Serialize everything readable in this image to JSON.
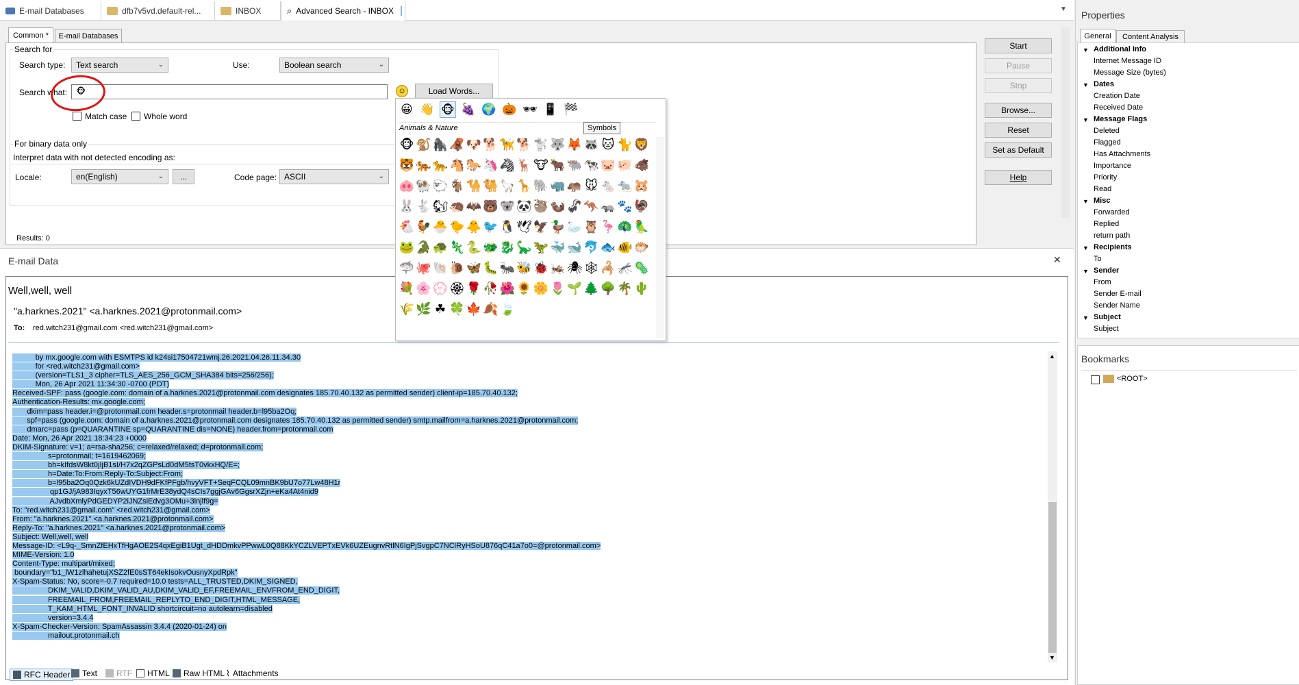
{
  "tabs": [
    {
      "label": "E-mail Databases",
      "icon": "envelope-icon"
    },
    {
      "label": "dfb7v5vd.default-rel...",
      "icon": "folder-icon"
    },
    {
      "label": "INBOX",
      "icon": "inbox-icon"
    },
    {
      "label": "Advanced Search - INBOX",
      "icon": "search-icon"
    }
  ],
  "search_tabs": [
    "Common *",
    "E-mail Databases"
  ],
  "search_for": {
    "group_title": "Search for",
    "search_type_label": "Search type:",
    "search_type_value": "Text search",
    "use_label": "Use:",
    "use_value": "Boolean search",
    "search_what_label": "Search what:",
    "search_what_value": "🐵",
    "load_words": "Load Words...",
    "match_case": "Match case",
    "whole_word": "Whole word"
  },
  "binary": {
    "group_title": "For binary data only",
    "interpret_label": "Interpret data with not detected encoding as:",
    "locale_label": "Locale:",
    "locale_value": "en(English)",
    "ellipsis": "...",
    "codepage_label": "Code page:",
    "codepage_value": "ASCII"
  },
  "action_buttons": {
    "start": "Start",
    "pause": "Pause",
    "stop": "Stop",
    "browse": "Browse...",
    "reset": "Reset",
    "set_default": "Set as Default",
    "help": "Help"
  },
  "results": "Results:   0",
  "emoji_picker": {
    "category_title": "Animals & Nature",
    "tooltip": "Symbols",
    "categories": [
      "😀",
      "👋",
      "🐵",
      "🍇",
      "🌍",
      "🎃",
      "🕶",
      "📱",
      "🏁"
    ],
    "rows": [
      [
        "🐵",
        "🐒",
        "🦍",
        "🦧",
        "🐶",
        "🐕",
        "🦮",
        "🐕",
        "🐩",
        "🐺",
        "🦊",
        "🦝",
        "🐱",
        "🐈",
        "🦁"
      ],
      [
        "🐯",
        "🐅",
        "🐆",
        "🐴",
        "🐎",
        "🦄",
        "🦓",
        "🦌",
        "🐮",
        "🐂",
        "🐃",
        "🐄",
        "🐷",
        "🐖",
        "🐗"
      ],
      [
        "🐽",
        "🐏",
        "🐑",
        "🐐",
        "🐪",
        "🐫",
        "🦙",
        "🦒",
        "🐘",
        "🦏",
        "🦛",
        "🐭",
        "🐁",
        "🐀",
        "🐹"
      ],
      [
        "🐰",
        "🐇",
        "🐿",
        "🦔",
        "🦇",
        "🐻",
        "🐨",
        "🐼",
        "🦥",
        "🦦",
        "🦨",
        "🦘",
        "🦡",
        "🐾",
        "🦃"
      ],
      [
        "🐔",
        "🐓",
        "🐣",
        "🐤",
        "🐥",
        "🐦",
        "🐧",
        "🕊",
        "🦅",
        "🦆",
        "🦢",
        "🦉",
        "🦩",
        "🦚",
        "🦜"
      ],
      [
        "🐸",
        "🐊",
        "🐢",
        "🦎",
        "🐍",
        "🐲",
        "🐉",
        "🦕",
        "🦖",
        "🐳",
        "🐋",
        "🐬",
        "🐟",
        "🐠",
        "🐡"
      ],
      [
        "🦈",
        "🐙",
        "🐚",
        "🐌",
        "🦋",
        "🐛",
        "🐜",
        "🐝",
        "🐞",
        "🦗",
        "🕷",
        "🕸",
        "🦂",
        "🦟",
        "🦠"
      ],
      [
        "💐",
        "🌸",
        "💮",
        "🏵",
        "🌹",
        "🥀",
        "🌺",
        "🌻",
        "🌼",
        "🌷",
        "🌱",
        "🌲",
        "🌳",
        "🌴",
        "🌵"
      ],
      [
        "🌾",
        "🌿",
        "☘",
        "🍀",
        "🍁",
        "🍂",
        "🍃"
      ]
    ]
  },
  "email_panel": {
    "title": "E-mail Data",
    "subject": "Well,well, well",
    "from": "\"a.harknes.2021\" <a.harknes.2021@protonmail.com>",
    "to_label": "To:",
    "to_value": "red.witch231@gmail.com <red.witch231@gmail.com>",
    "header_lines": [
      "           by mx.google.com with ESMTPS id k24si17504721wmj.26.2021.04.26.11.34.30",
      "           for <red.witch231@gmail.com>",
      "           (version=TLS1_3 cipher=TLS_AES_256_GCM_SHA384 bits=256/256);",
      "           Mon, 26 Apr 2021 11:34:30 -0700 (PDT)",
      "Received-SPF: pass (google.com: domain of a.harknes.2021@protonmail.com designates 185.70.40.132 as permitted sender) client-ip=185.70.40.132;",
      "Authentication-Results: mx.google.com;",
      "       dkim=pass header.i=@protonmail.com header.s=protonmail header.b=l95ba2Oq;",
      "       spf=pass (google.com: domain of a.harknes.2021@protonmail.com designates 185.70.40.132 as permitted sender) smtp.mailfrom=a.harknes.2021@protonmail.com;",
      "       dmarc=pass (p=QUARANTINE sp=QUARANTINE dis=NONE) header.from=protonmail.com",
      "Date: Mon, 26 Apr 2021 18:34:23 +0000",
      "DKIM-Signature: v=1; a=rsa-sha256; c=relaxed/relaxed; d=protonmail.com;",
      "                 s=protonmail; t=1619462069;",
      "                 bh=kIfdsW8kt0jIjB1sI/H7x2qZGPsLd0dM5tsT0vkxHQ/E=;",
      "                 h=Date:To:From:Reply-To:Subject:From;",
      "                 b=l95ba2Oq0Qzk6kUZdIVDH9dFKfPFgb/hvyVFT+SeqFCQL09mnBK9bU7o77Lw48H1r",
      "                  qp1GJ/jA983IqyxT56wUYG1frMrE38ydQ4sCIs7ggjGAv6GgsrXZjn+eKa4At4nid9",
      "                  AJvdbXmlyPdGEDYP2iJNZsiEdvg3OMu+3lnjlf9g=",
      "To: \"red.witch231@gmail.com\" <red.witch231@gmail.com>",
      "From: \"a.harknes.2021\" <a.harknes.2021@protonmail.com>",
      "Reply-To: \"a.harknes.2021\" <a.harknes.2021@protonmail.com>",
      "Subject: Well,well, well",
      "Message-ID: <L9q-_SmnZfEHxTfHgAOE2S4qxEgiB1Ugt_dHDDmkvPPwwL0Q88KkYCZLVEPTxEVk6UZEugnvRtlN6IgPjSvgpC7NClRyHSoU876qC41a7o0=@protonmail.com>",
      "MIME-Version: 1.0",
      "Content-Type: multipart/mixed;",
      " boundary=\"b1_lW1zlhahetujXSZ2fE0sST64ekIsokvOusnyXpdRpk\"",
      "X-Spam-Status: No, score=-0.7 required=10.0 tests=ALL_TRUSTED,DKIM_SIGNED,",
      "                 DKIM_VALID,DKIM_VALID_AU,DKIM_VALID_EF,FREEMAIL_ENVFROM_END_DIGIT,",
      "                 FREEMAIL_FROM,FREEMAIL_REPLYTO_END_DIGIT,HTML_MESSAGE,",
      "                 T_KAM_HTML_FONT_INVALID shortcircuit=no autolearn=disabled",
      "                 version=3.4.4",
      "X-Spam-Checker-Version: SpamAssassin 3.4.4 (2020-01-24) on",
      "                 mailout.protonmail.ch"
    ],
    "bottom_tabs": [
      {
        "label": "RFC Header",
        "icon": "rfc-header-icon"
      },
      {
        "label": "Text",
        "icon": "text-icon"
      },
      {
        "label": "RTF",
        "icon": "rtf-icon"
      },
      {
        "label": "HTML",
        "icon": "html-icon"
      },
      {
        "label": "Raw HTML",
        "icon": "raw-html-icon"
      },
      {
        "label": "Attachments",
        "icon": "paperclip-icon"
      }
    ]
  },
  "properties": {
    "title": "Properties",
    "tabs": [
      "General",
      "Content Analysis"
    ],
    "sections": [
      {
        "name": "Additional Info",
        "items": [
          "Internet Message ID",
          "Message Size (bytes)"
        ]
      },
      {
        "name": "Dates",
        "items": [
          "Creation Date",
          "Received Date"
        ]
      },
      {
        "name": "Message Flags",
        "items": [
          "Deleted",
          "Flagged",
          "Has Attachments",
          "Importance",
          "Priority",
          "Read"
        ]
      },
      {
        "name": "Misc",
        "items": [
          "Forwarded",
          "Replied",
          "return path"
        ]
      },
      {
        "name": "Recipients",
        "items": [
          "To"
        ]
      },
      {
        "name": "Sender",
        "items": [
          "From",
          "Sender E-mail",
          "Sender Name"
        ]
      },
      {
        "name": "Subject",
        "items": [
          "Subject"
        ]
      }
    ]
  },
  "bookmarks": {
    "title": "Bookmarks",
    "root": "<ROOT>"
  },
  "colors": {
    "selection": "#99c9ef",
    "accent": "#0078d7"
  }
}
